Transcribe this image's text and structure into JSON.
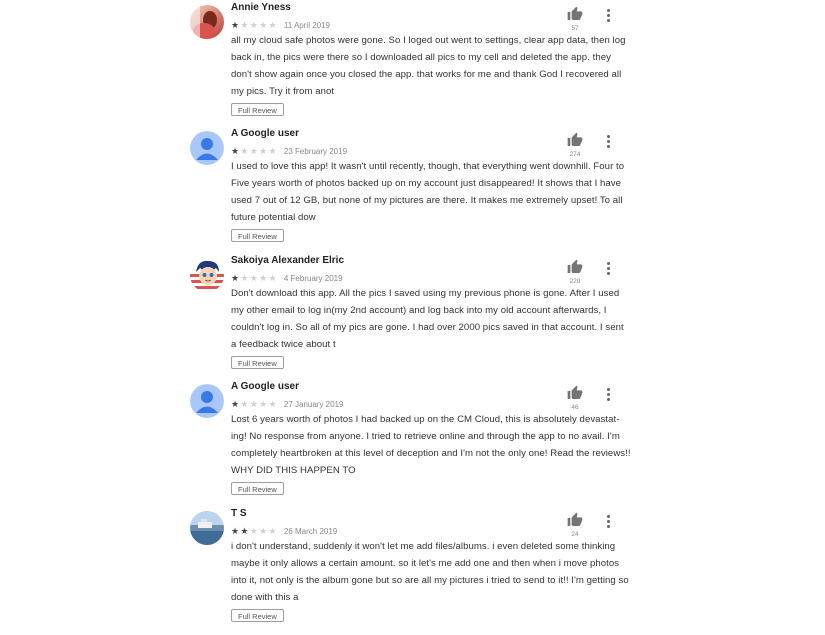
{
  "reviews": [
    {
      "author": "Annie Yness",
      "rating": 1,
      "date": "11 April 2019",
      "likes": "57",
      "text": "all my cloud safe photos were gone. So I loged out went to settings, clear app data, then log back in, the pics were there so I downloaded all pics to my cell and deleted the app. they don't show again once you closed the app. that works for me and thank God I recovered all my pics. Try it from anot",
      "avatar": "photo-avatar"
    },
    {
      "author": "A Google user",
      "rating": 1,
      "date": "23 February 2019",
      "likes": "274",
      "text": "I used to love this app! It wasn't until recently, though, that everything went downhill. Four to Five years worth of photos backed up on my account just disappeared! It shows that I have used 7 out of 12 GB, but none of my pictures are there. It makes me extremely upset! To all future potential dow",
      "avatar": "default-user-avatar"
    },
    {
      "author": "Sakoiya Alexander Elric",
      "rating": 1,
      "date": "4 February 2019",
      "likes": "229",
      "text": "Don't download this app. All the pics I saved using my previous phone is gone. After I used my other email to log in(my 2nd account) and log back into my old account afterwards, I couldn't log in. So all of my pics are gone. I had over 2000 pics saved in that account. I sent a feedback twice about t",
      "avatar": "cartoon-avatar"
    },
    {
      "author": "A Google user",
      "rating": 1,
      "date": "27 January 2019",
      "likes": "46",
      "text": "Lost 6 years worth of photos I had backed up on the CM Cloud, this is absolutely devastat-ing! No response from anyone. I tried to retrieve online and through the app to no avail. I'm completely heartbroken at this level of deception and I'm not the only one! Read the reviews!! WHY DID THIS HAPPEN TO",
      "avatar": "default-user-avatar"
    },
    {
      "author": "T S",
      "rating": 2,
      "date": "26 March 2019",
      "likes": "24",
      "text": "i don't understand, suddenly it won't let me add files/albums. i even deleted some thinking maybe it only allows a certain amount. so it let's me add one and then when i move photos into it, not only is the album gone but so are all my pictures i tried to send to it!! I'm getting so done with this a",
      "avatar": "landscape-avatar"
    }
  ],
  "full_review_label": "Full Review",
  "colors": {
    "star_filled": "#444444",
    "star_empty": "#d0d0d0",
    "default_avatar_bg": "#a8c7fa",
    "default_avatar_fg": "#3b78e7"
  }
}
